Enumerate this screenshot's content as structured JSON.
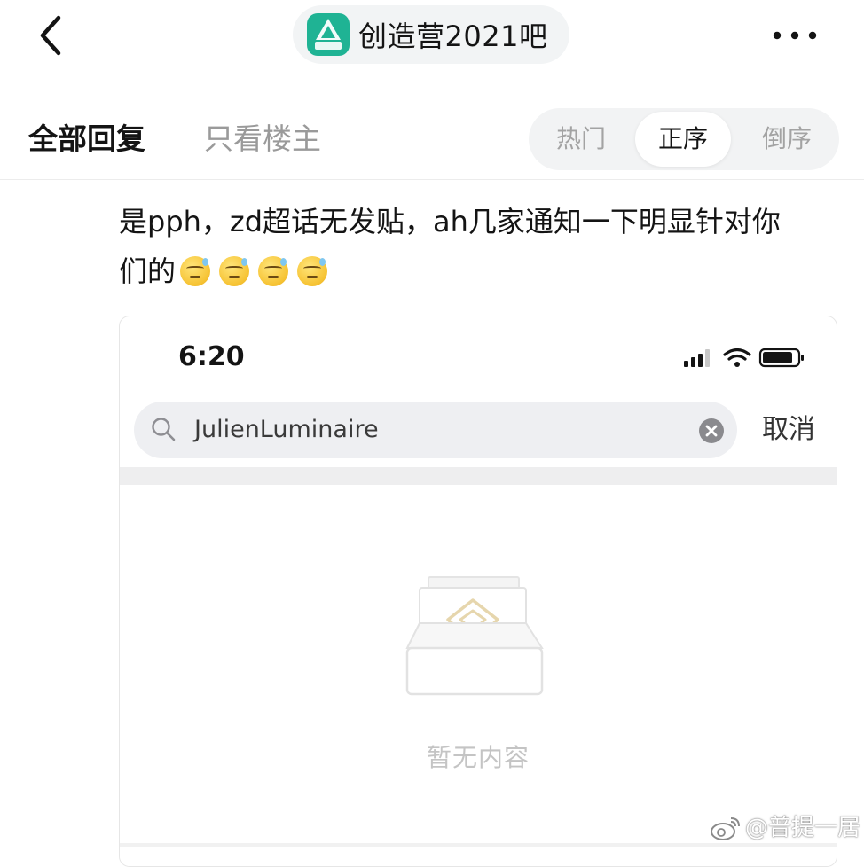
{
  "header": {
    "forum_name": "创造营2021吧",
    "logo_text": "创造营"
  },
  "tabs": {
    "all_replies": "全部回复",
    "only_op": "只看楼主"
  },
  "sort": {
    "hot": "热门",
    "ascending": "正序",
    "descending": "倒序",
    "selected": "正序"
  },
  "post": {
    "line1": "是pph，zd超话无发贴，ah几家通知一下明显针对你",
    "line2": "们的",
    "emoji_count": 4,
    "emoji_icon": "sweat-smile-emoji"
  },
  "embedded_screenshot": {
    "status_time": "6:20",
    "search": {
      "value": "JulienLuminaire",
      "cancel_label": "取消"
    },
    "empty_text": "暂无内容"
  },
  "watermark": {
    "text": "@普提一居"
  },
  "colors": {
    "logo_green": "#1fb394",
    "muted_text": "#9a9a9a",
    "pill_bg": "#f2f3f4"
  }
}
